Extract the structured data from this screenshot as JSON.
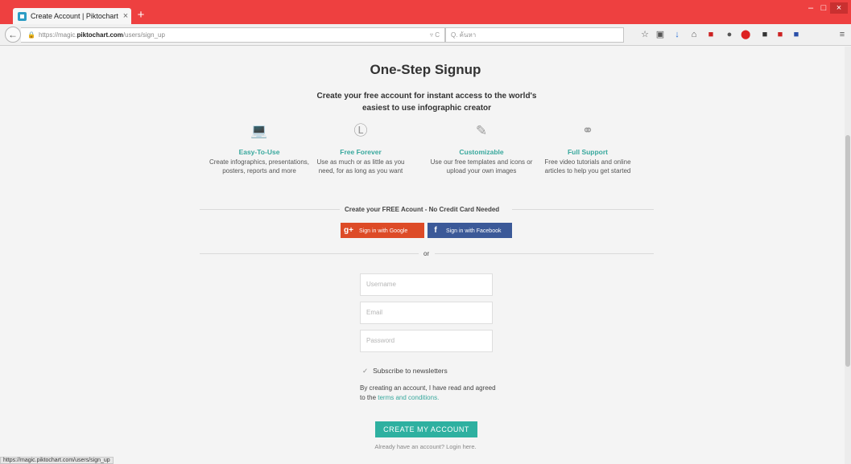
{
  "browser": {
    "tab_title": "Create Account | Piktochart",
    "tab_close": "×",
    "new_tab": "+",
    "win_minimize": "–",
    "win_maximize": "□",
    "win_close": "×",
    "url_prefix": "https://magic.",
    "url_host": "piktochart.com",
    "url_path": "/users/sign_up",
    "url_actions": "▿ C",
    "search_placeholder": "Q. ค้นหา",
    "status_url": "https://magic.piktochart.com/users/sign_up"
  },
  "page": {
    "title": "One-Step Signup",
    "subtitle": "Create your free account for instant access to the world's easiest to use infographic creator",
    "features": [
      {
        "icon": "laptop-icon",
        "title": "Easy-To-Use",
        "desc": "Create infographics, presentations, posters, reports and more"
      },
      {
        "icon": "dollar-icon",
        "title": "Free Forever",
        "desc": "Use as much or as little as you need, for as long as you want"
      },
      {
        "icon": "pencil-icon",
        "title": "Customizable",
        "desc": "Use our free templates and icons or upload your own images"
      },
      {
        "icon": "headset-icon",
        "title": "Full Support",
        "desc": "Free video tutorials and online articles to help you get started"
      }
    ],
    "account_divider": "Create your FREE Acount - No Credit Card Needed",
    "google_icon": "g+",
    "google_label": "Sign in with Google",
    "facebook_icon": "f",
    "facebook_label": "Sign in with Facebook",
    "or_label": "or",
    "username_placeholder": "Username",
    "email_placeholder": "Email",
    "password_placeholder": "Password",
    "subscribe_label": "Subscribe to newsletters",
    "subscribe_checked": true,
    "terms_prefix": "By creating an account, I have read and agreed to the",
    "terms_link": "terms and conditions.",
    "create_button": "CREATE MY ACCOUNT",
    "login_text": "Already have an account? Login here."
  },
  "colors": {
    "accent": "#38a89d",
    "google": "#dd4b27",
    "facebook": "#3b5998",
    "firefox_red": "#ee4040"
  }
}
